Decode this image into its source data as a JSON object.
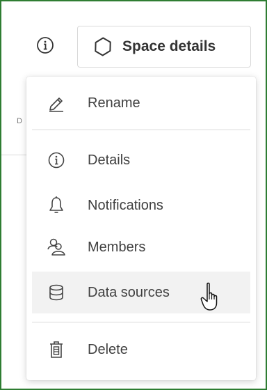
{
  "header": {
    "space_details_label": "Space details"
  },
  "background": {
    "fragment": "D"
  },
  "menu": {
    "items": [
      {
        "label": "Rename",
        "icon": "pencil-icon"
      },
      {
        "label": "Details",
        "icon": "info-icon"
      },
      {
        "label": "Notifications",
        "icon": "bell-icon"
      },
      {
        "label": "Members",
        "icon": "members-icon"
      },
      {
        "label": "Data sources",
        "icon": "database-icon",
        "hovered": true
      },
      {
        "label": "Delete",
        "icon": "trash-icon"
      }
    ]
  },
  "colors": {
    "frame_border": "#2e7d32",
    "hover_bg": "#f2f2f2",
    "text": "#404040"
  }
}
